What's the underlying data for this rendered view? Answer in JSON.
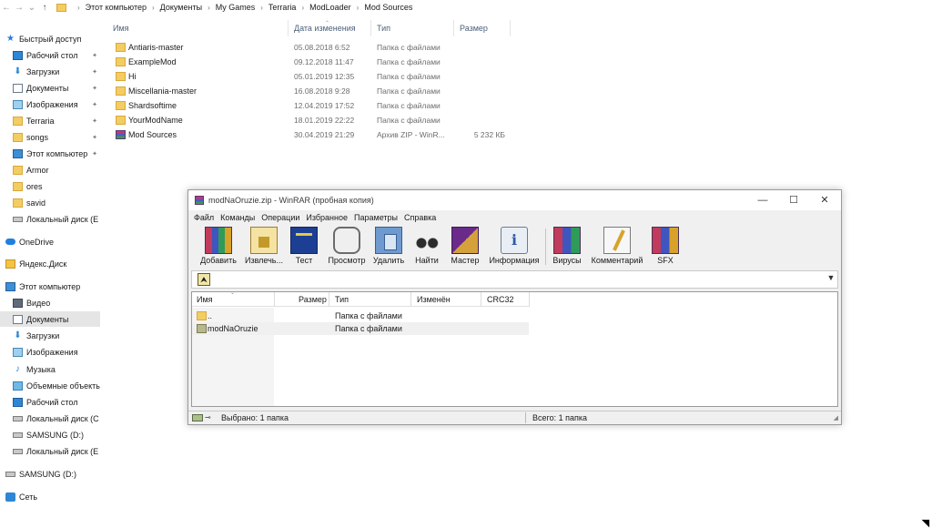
{
  "explorer": {
    "nav_buttons": {
      "back": "←",
      "forward": "→",
      "dropdown": "⌄",
      "up": "↑"
    },
    "breadcrumbs": [
      "Этот компьютер",
      "Документы",
      "My Games",
      "Terraria",
      "ModLoader",
      "Mod Sources"
    ],
    "breadcrumb_sep": "›",
    "sidebar": [
      {
        "label": "Быстрый доступ",
        "icon": "star-icon",
        "pinned": false
      },
      {
        "label": "Рабочий стол",
        "icon": "desktop-icon",
        "pinned": true
      },
      {
        "label": "Загрузки",
        "icon": "downloads-icon",
        "pinned": true
      },
      {
        "label": "Документы",
        "icon": "documents-icon",
        "pinned": true
      },
      {
        "label": "Изображения",
        "icon": "pictures-icon",
        "pinned": true
      },
      {
        "label": "Terraria",
        "icon": "folder-icon",
        "pinned": true
      },
      {
        "label": "songs",
        "icon": "folder-icon",
        "pinned": true
      },
      {
        "label": "Этот компьютер",
        "icon": "computer-icon",
        "pinned": true
      },
      {
        "label": "Armor",
        "icon": "folder-icon",
        "pinned": false
      },
      {
        "label": "ores",
        "icon": "folder-icon",
        "pinned": false
      },
      {
        "label": "savid",
        "icon": "folder-icon",
        "pinned": false
      },
      {
        "label": "Локальный диск (E",
        "icon": "drive-icon",
        "pinned": false
      },
      {
        "label": "OneDrive",
        "icon": "onedrive-icon",
        "pinned": false
      },
      {
        "label": "Яндекс.Диск",
        "icon": "yandex-disk-icon",
        "pinned": false
      },
      {
        "label": "Этот компьютер",
        "icon": "computer-icon",
        "pinned": false
      },
      {
        "label": "Видео",
        "icon": "video-icon",
        "pinned": false
      },
      {
        "label": "Документы",
        "icon": "documents-icon",
        "pinned": false,
        "selected": true
      },
      {
        "label": "Загрузки",
        "icon": "downloads-icon",
        "pinned": false
      },
      {
        "label": "Изображения",
        "icon": "pictures-icon",
        "pinned": false
      },
      {
        "label": "Музыка",
        "icon": "music-icon",
        "pinned": false
      },
      {
        "label": "Объемные объекты",
        "icon": "3d-objects-icon",
        "pinned": false
      },
      {
        "label": "Рабочий стол",
        "icon": "desktop-icon",
        "pinned": false
      },
      {
        "label": "Локальный диск (C",
        "icon": "drive-icon",
        "pinned": false
      },
      {
        "label": "SAMSUNG (D:)",
        "icon": "drive-icon",
        "pinned": false
      },
      {
        "label": "Локальный диск (E",
        "icon": "drive-icon",
        "pinned": false
      },
      {
        "label": "SAMSUNG (D:)",
        "icon": "drive-icon",
        "pinned": false
      },
      {
        "label": "Сеть",
        "icon": "network-icon",
        "pinned": false
      }
    ],
    "pin_glyph": "📌",
    "columns": {
      "name": "Имя",
      "date": "Дата изменения",
      "type": "Тип",
      "size": "Размер"
    },
    "files": [
      {
        "name": "Antiaris-master",
        "date": "05.08.2018 6:52",
        "type": "Папка с файлами",
        "size": "",
        "kind": "folder"
      },
      {
        "name": "ExampleMod",
        "date": "09.12.2018 11:47",
        "type": "Папка с файлами",
        "size": "",
        "kind": "folder"
      },
      {
        "name": "Hi",
        "date": "05.01.2019 12:35",
        "type": "Папка с файлами",
        "size": "",
        "kind": "folder"
      },
      {
        "name": "Miscellania-master",
        "date": "16.08.2018 9:28",
        "type": "Папка с файлами",
        "size": "",
        "kind": "folder"
      },
      {
        "name": "Shardsoftime",
        "date": "12.04.2019 17:52",
        "type": "Папка с файлами",
        "size": "",
        "kind": "folder"
      },
      {
        "name": "YourModName",
        "date": "18.01.2019 22:22",
        "type": "Папка с файлами",
        "size": "",
        "kind": "folder"
      },
      {
        "name": "Mod Sources",
        "date": "30.04.2019 21:29",
        "type": "Архив ZIP - WinR...",
        "size": "5 232 КБ",
        "kind": "zip"
      }
    ]
  },
  "winrar": {
    "title": "modNaOruzie.zip - WinRAR (пробная копия)",
    "window_controls": {
      "minimize": "—",
      "maximize": "☐",
      "close": "✕"
    },
    "menu": [
      "Файл",
      "Команды",
      "Операции",
      "Избранное",
      "Параметры",
      "Справка"
    ],
    "toolbar": [
      {
        "label": "Добавить",
        "icon": "add-archive-icon"
      },
      {
        "label": "Извлечь...",
        "icon": "extract-icon"
      },
      {
        "label": "Тест",
        "icon": "test-icon"
      },
      {
        "label": "Просмотр",
        "icon": "view-icon"
      },
      {
        "label": "Удалить",
        "icon": "delete-icon"
      },
      {
        "label": "Найти",
        "icon": "find-icon"
      },
      {
        "label": "Мастер",
        "icon": "wizard-icon"
      },
      {
        "label": "Информация",
        "icon": "info-icon"
      },
      {
        "label": "Вирусы",
        "icon": "virus-scan-icon"
      },
      {
        "label": "Комментарий",
        "icon": "comment-icon"
      },
      {
        "label": "SFX",
        "icon": "sfx-icon"
      }
    ],
    "up_glyph": "⮝",
    "columns": {
      "name": "Имя",
      "size": "Размер",
      "type": "Тип",
      "modified": "Изменён",
      "crc": "CRC32"
    },
    "rows": [
      {
        "name": "..",
        "type": "Папка с файлами",
        "kind": "folder",
        "selected": false
      },
      {
        "name": "modNaOruzie",
        "type": "Папка с файлами",
        "kind": "folder-archive",
        "selected": true
      }
    ],
    "status": {
      "left": "Выбрано: 1 папка",
      "right": "Всего: 1 папка"
    },
    "colors": {
      "accent": "#f3cd62",
      "window_bg": "#f0f0f0"
    }
  }
}
